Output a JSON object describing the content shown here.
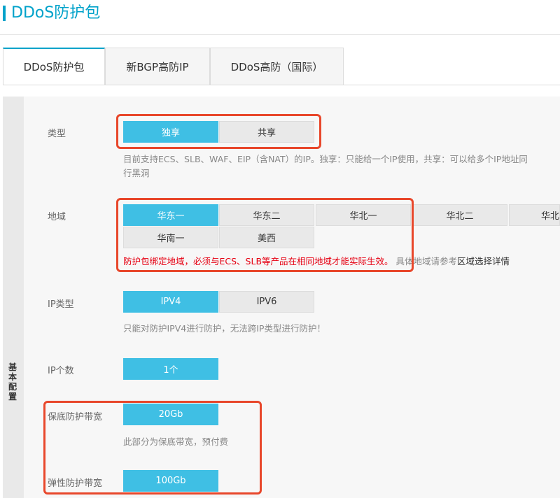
{
  "header": {
    "title": "DDoS防护包"
  },
  "tabs": [
    {
      "label": "DDoS防护包"
    },
    {
      "label": "新BGP高防IP"
    },
    {
      "label": "DDoS高防（国际）"
    }
  ],
  "section": {
    "label": "基本配置"
  },
  "type_row": {
    "label": "类型",
    "options": [
      "独享",
      "共享"
    ],
    "selected": "独享",
    "desc_line1": "目前支持ECS、SLB、WAF、EIP（含NAT）的IP。独享：只能给一个IP使用，共享：可以给多个IP地址同",
    "desc_line2": "行黑洞"
  },
  "region_row": {
    "label": "地域",
    "options": [
      "华东一",
      "华东二",
      "华北一",
      "华北二",
      "华北",
      "华南一",
      "美西"
    ],
    "selected": "华东一",
    "warning": "防护包绑定地域，必须与ECS、SLB等产品在相同地域才能实际生效。",
    "hint": "具体地域请参考",
    "link": "区域选择详情"
  },
  "ip_type_row": {
    "label": "IP类型",
    "options": [
      "IPV4",
      "IPV6"
    ],
    "selected": "IPV4",
    "desc": "只能对防护IPV4进行防护，无法跨IP类型进行防护！"
  },
  "ip_count_row": {
    "label": "IP个数",
    "value": "1个"
  },
  "base_bw_row": {
    "label": "保底防护带宽",
    "value": "20Gb",
    "desc": "此部分为保底带宽，预付费"
  },
  "elastic_bw_row": {
    "label": "弹性防护带宽",
    "value": "100Gb"
  }
}
